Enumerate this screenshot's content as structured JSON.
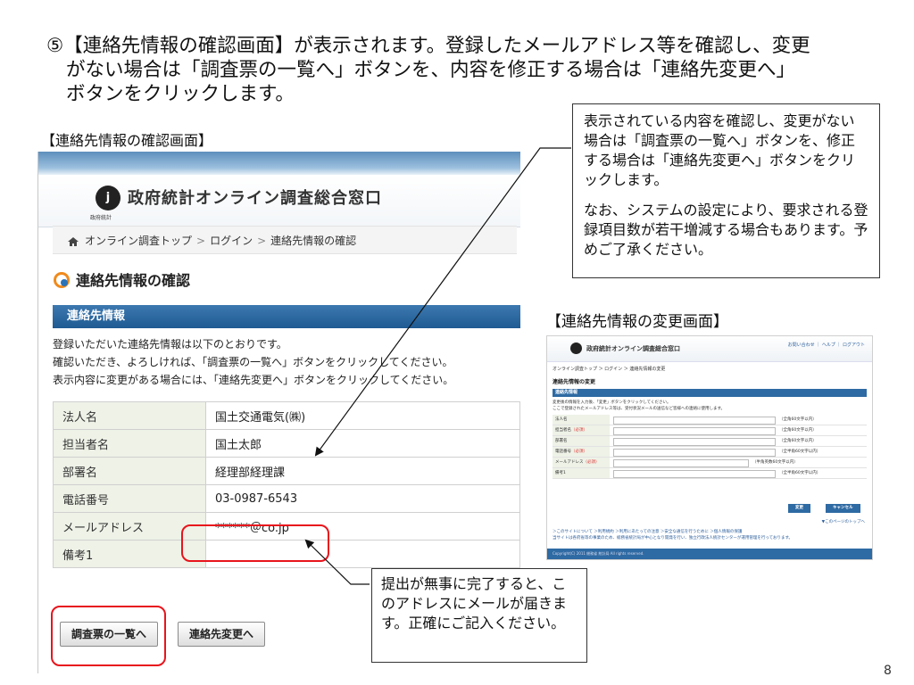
{
  "heading": {
    "line1": "⑤【連絡先情報の確認画面】が表示されます。登録したメールアドレス等を確認し、変更",
    "line2": "がない場合は「調査票の一覧へ」ボタンを、内容を修正する場合は「連絡先変更へ」",
    "line3": "ボタンをクリックします。"
  },
  "confirm_caption": "【連絡先情報の確認画面】",
  "change_caption": "【連絡先情報の変更画面】",
  "screenshot": {
    "logo_text": "政府統計",
    "site_title": "政府統計オンライン調査総合窓口",
    "breadcrumb": [
      "オンライン調査トップ",
      "ログイン",
      "連絡先情報の確認"
    ],
    "page_title": "連絡先情報の確認",
    "section_title": "連絡先情報",
    "description": [
      "登録いただいた連絡先情報は以下のとおりです。",
      "確認いただき、よろしければ、「調査票の一覧へ」ボタンをクリックしてください。",
      "表示内容に変更がある場合には、「連絡先変更へ」ボタンをクリックしてください。"
    ],
    "rows": [
      {
        "label": "法人名",
        "value": "国土交通電気(㈱)"
      },
      {
        "label": "担当者名",
        "value": "国土太郎"
      },
      {
        "label": "部署名",
        "value": "経理部経理課"
      },
      {
        "label": "電話番号",
        "value": "03-0987-6543"
      },
      {
        "label": "メールアドレス",
        "value": "******＠co.jp"
      },
      {
        "label": "備考1",
        "value": ""
      }
    ],
    "list_button": "調査票の一覧へ",
    "change_button": "連絡先変更へ"
  },
  "callout_top": {
    "p1": "表示されている内容を確認し、変更がない場合は「調査票の一覧へ」ボタンを、修正する場合は「連絡先変更へ」ボタンをクリックします。",
    "p2": "なお、システムの設定により、要求される登録項目数が若干増減する場合もあります。予めご了承ください。"
  },
  "callout_bottom": "提出が無事に完了すると、このアドレスにメールが届きます。正確にご記入ください。",
  "mini": {
    "site_title": "政府統計オンライン調査総合窓口",
    "links": "お問い合わせ ｜ ヘルプ ｜ ログアウト",
    "breadcrumb": "オンライン調査トップ ＞ ログイン ＞ 連絡先情報の変更",
    "page_title": "連絡先情報の変更",
    "section_title": "連絡先情報",
    "desc1": "変更後の情報を入力後、「変更」ボタンをクリックしてください。",
    "desc2": "ここで登録されたメールアドレス等は、受付状況メールの送信など皆様への連絡に使用します。",
    "rows": [
      {
        "label": "法人名",
        "req": "",
        "note": "（全角60文字以内）"
      },
      {
        "label": "担当者名",
        "req": "（必須）",
        "note": "（全角60文字以内）"
      },
      {
        "label": "部署名",
        "req": "",
        "note": "（全角60文字以内）"
      },
      {
        "label": "電話番号",
        "req": "（必須）",
        "note": "（全半角60文字以内）"
      },
      {
        "label": "メールアドレス",
        "req": "（必須）",
        "note": "（半角英数60文字以内）"
      },
      {
        "label": "備考1",
        "req": "",
        "note": "（全半角60文字以内）"
      }
    ],
    "change_btn": "変更",
    "cancel_btn": "キャンセル",
    "page_top": "▼このページのトップへ",
    "footer1": "＞このサイトについて ＞利用規約 ＞利用にあたっての注意 ＞安全な通信を行うために ＞個人情報の保護",
    "footer2": "当サイトは各府省等の事業のため、総務省統計局が中心となり開発を行い、独立行政法人統計センターが運用管理を行っております。",
    "copyright": "Copyright(C) 2011 総務省 統計局 All rights reserved."
  },
  "page_number": "8",
  "colors": {
    "highlight": "#e8141c",
    "header_blue": "#1f5a93"
  }
}
